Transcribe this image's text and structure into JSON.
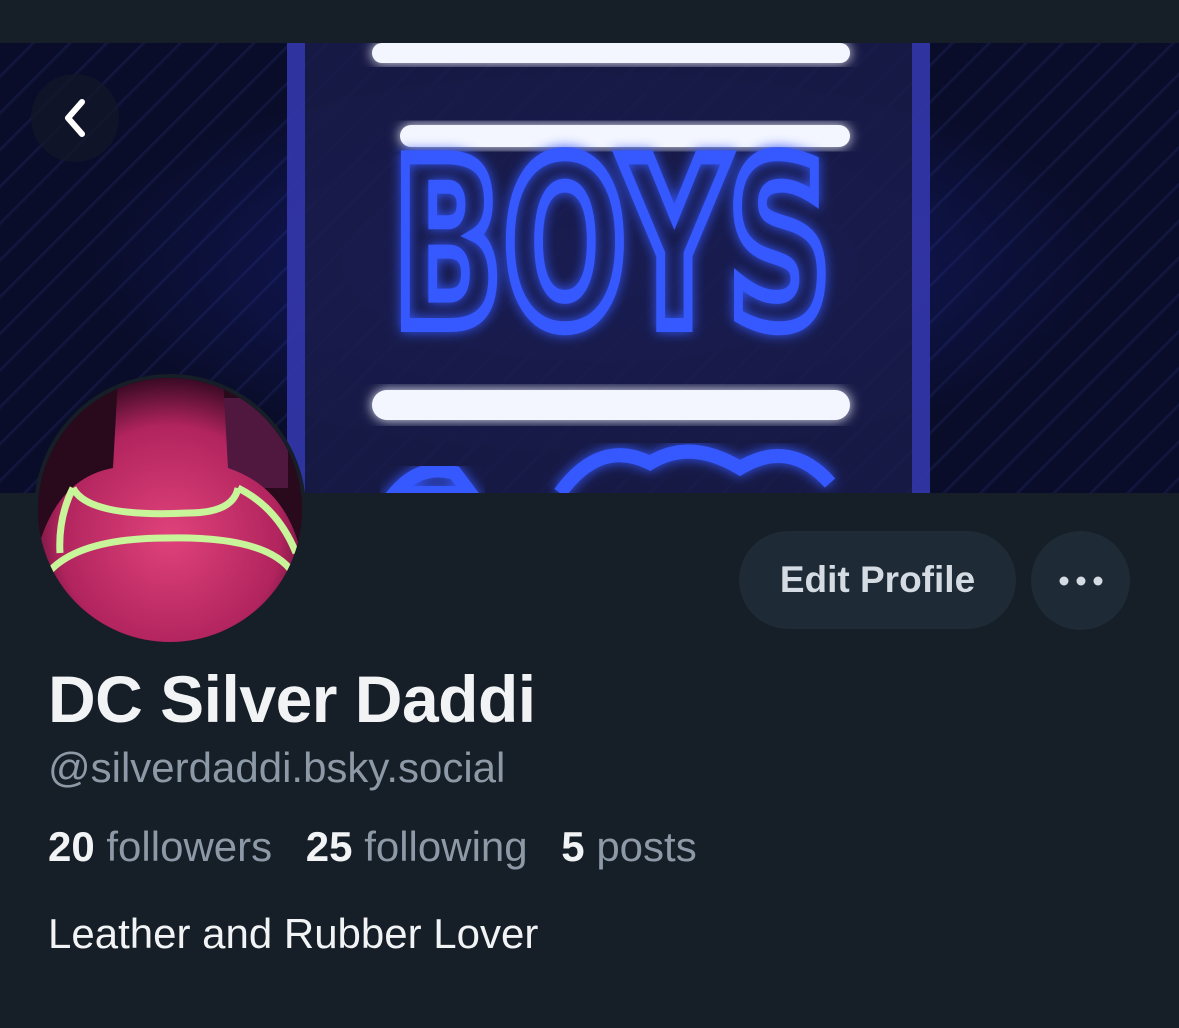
{
  "profile": {
    "display_name": "DC Silver Daddi",
    "handle": "@silverdaddi.bsky.social",
    "bio": "Leather and Rubber Lover",
    "banner_sign_text": "BOYS"
  },
  "stats": {
    "followers_count": "20",
    "followers_label": "followers",
    "following_count": "25",
    "following_label": "following",
    "posts_count": "5",
    "posts_label": "posts"
  },
  "actions": {
    "edit_profile_label": "Edit Profile",
    "back_icon": "chevron-left-icon",
    "more_icon": "ellipsis-icon"
  },
  "colors": {
    "background": "#161e27",
    "button_background": "#1e2a36",
    "primary_text": "#f1f3f5",
    "secondary_text": "#8d99a6",
    "neon_blue": "#2f52ff"
  }
}
